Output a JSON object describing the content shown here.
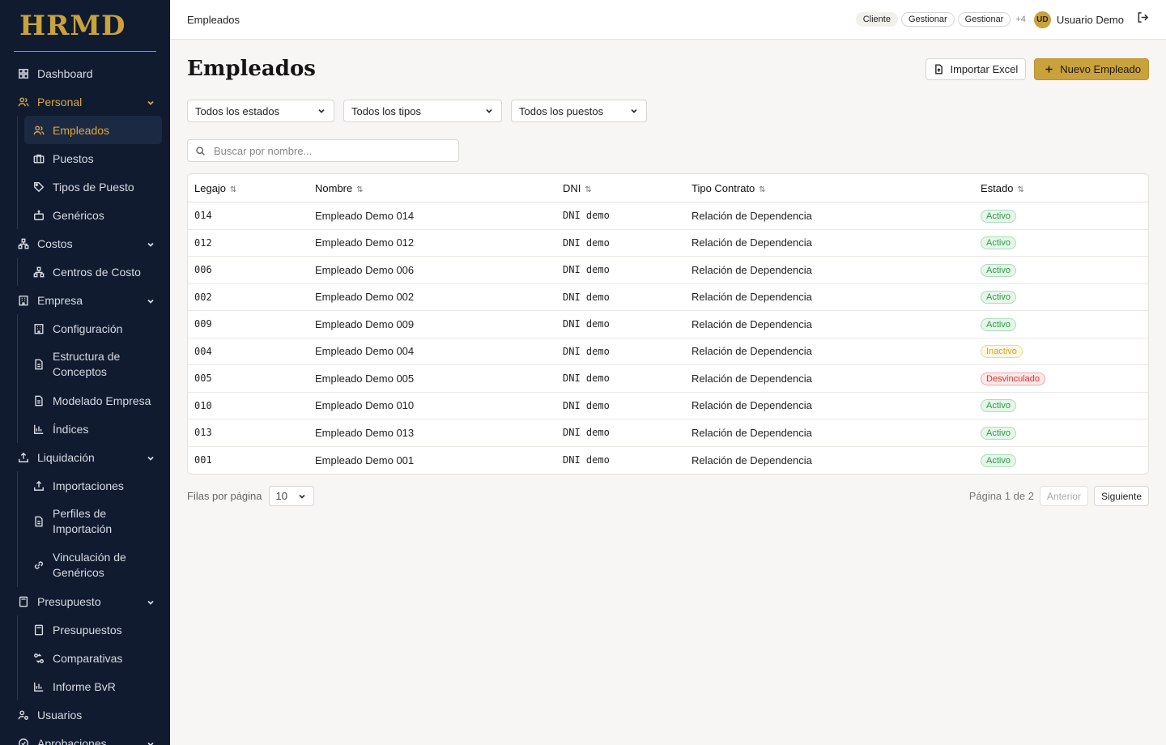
{
  "brand": "HRMD",
  "sidebar": {
    "items": [
      {
        "label": "Dashboard"
      },
      {
        "label": "Personal",
        "children": [
          "Empleados",
          "Puestos",
          "Tipos de Puesto",
          "Genéricos"
        ]
      },
      {
        "label": "Costos",
        "children": [
          "Centros de Costo"
        ]
      },
      {
        "label": "Empresa",
        "children": [
          "Configuración",
          "Estructura de Conceptos",
          "Modelado Empresa",
          "Índices"
        ]
      },
      {
        "label": "Liquidación",
        "children": [
          "Importaciones",
          "Perfiles de Importación",
          "Vinculación de Genéricos"
        ]
      },
      {
        "label": "Presupuesto",
        "children": [
          "Presupuestos",
          "Comparativas",
          "Informe BvR"
        ]
      },
      {
        "label": "Usuarios"
      },
      {
        "label": "Aprobaciones"
      }
    ]
  },
  "header": {
    "breadcrumb": "Empleados",
    "roles": [
      "Cliente",
      "Gestionar",
      "Gestionar"
    ],
    "more_roles": "+4",
    "avatar_initials": "UD",
    "user_name": "Usuario Demo"
  },
  "main": {
    "title": "Empleados",
    "import_label": "Importar Excel",
    "new_label": "Nuevo Empleado",
    "filters": [
      "Todos los estados",
      "Todos los tipos",
      "Todos los puestos"
    ],
    "search_placeholder": "Buscar por nombre...",
    "columns": [
      "Legajo",
      "Nombre",
      "DNI",
      "Tipo Contrato",
      "Estado"
    ],
    "rows": [
      {
        "legajo": "014",
        "nombre": "Empleado Demo 014",
        "dni": "DNI demo",
        "tipo": "Relación de Dependencia",
        "estado": "Activo"
      },
      {
        "legajo": "012",
        "nombre": "Empleado Demo 012",
        "dni": "DNI demo",
        "tipo": "Relación de Dependencia",
        "estado": "Activo"
      },
      {
        "legajo": "006",
        "nombre": "Empleado Demo 006",
        "dni": "DNI demo",
        "tipo": "Relación de Dependencia",
        "estado": "Activo"
      },
      {
        "legajo": "002",
        "nombre": "Empleado Demo 002",
        "dni": "DNI demo",
        "tipo": "Relación de Dependencia",
        "estado": "Activo"
      },
      {
        "legajo": "009",
        "nombre": "Empleado Demo 009",
        "dni": "DNI demo",
        "tipo": "Relación de Dependencia",
        "estado": "Activo"
      },
      {
        "legajo": "004",
        "nombre": "Empleado Demo 004",
        "dni": "DNI demo",
        "tipo": "Relación de Dependencia",
        "estado": "Inactivo"
      },
      {
        "legajo": "005",
        "nombre": "Empleado Demo 005",
        "dni": "DNI demo",
        "tipo": "Relación de Dependencia",
        "estado": "Desvinculado"
      },
      {
        "legajo": "010",
        "nombre": "Empleado Demo 010",
        "dni": "DNI demo",
        "tipo": "Relación de Dependencia",
        "estado": "Activo"
      },
      {
        "legajo": "013",
        "nombre": "Empleado Demo 013",
        "dni": "DNI demo",
        "tipo": "Relación de Dependencia",
        "estado": "Activo"
      },
      {
        "legajo": "001",
        "nombre": "Empleado Demo 001",
        "dni": "DNI demo",
        "tipo": "Relación de Dependencia",
        "estado": "Activo"
      }
    ],
    "rows_per_page_label": "Filas por página",
    "rows_per_page": "10",
    "page_info": "Página 1 de 2",
    "prev_label": "Anterior",
    "next_label": "Siguiente"
  },
  "colors": {
    "sidebar_bg": "#101b30",
    "accent": "#c9a23c",
    "active_text": "#d9a940",
    "status_activo": "#2f9a4a",
    "status_inactivo": "#d6a31c",
    "status_desvinculado": "#d23535"
  }
}
